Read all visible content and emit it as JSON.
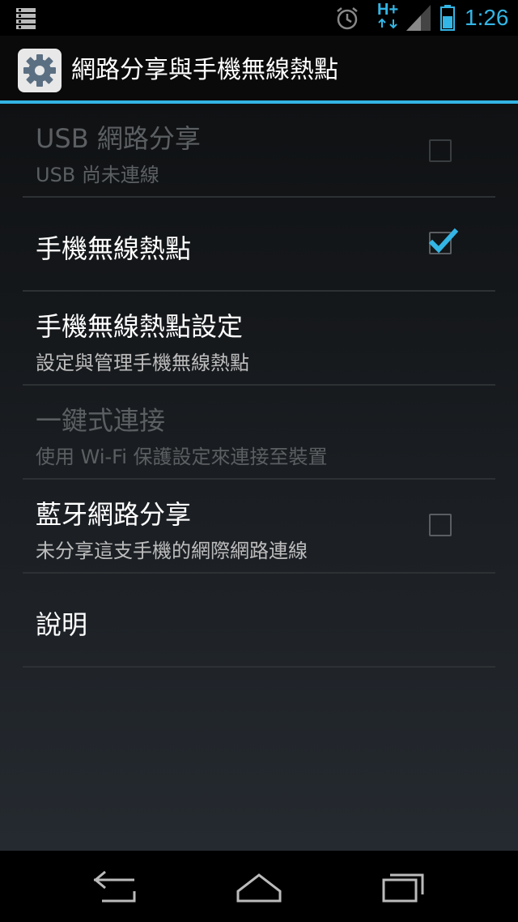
{
  "status_bar": {
    "network_type": "H+",
    "time": "1:26",
    "accent_color": "#33b5e5",
    "icons": [
      "notifications-icon",
      "alarm-icon",
      "signal-icon",
      "battery-icon"
    ]
  },
  "action_bar": {
    "title": "網路分享與手機無線熱點",
    "icon": "settings-gear-icon"
  },
  "preferences": [
    {
      "title": "USB 網路分享",
      "summary": "USB 尚未連線",
      "enabled": false,
      "has_checkbox": true,
      "checked": false
    },
    {
      "title": "手機無線熱點",
      "summary": "",
      "enabled": true,
      "has_checkbox": true,
      "checked": true
    },
    {
      "title": "手機無線熱點設定",
      "summary": "設定與管理手機無線熱點",
      "enabled": true,
      "has_checkbox": false
    },
    {
      "title": "一鍵式連接",
      "summary": "使用 Wi-Fi 保護設定來連接至裝置",
      "enabled": false,
      "has_checkbox": false
    },
    {
      "title": "藍牙網路分享",
      "summary": "未分享這支手機的網際網路連線",
      "enabled": true,
      "has_checkbox": true,
      "checked": false
    },
    {
      "title": "說明",
      "summary": "",
      "enabled": true,
      "has_checkbox": false
    }
  ],
  "nav_bar": {
    "buttons": [
      "back-icon",
      "home-icon",
      "recent-apps-icon"
    ]
  }
}
